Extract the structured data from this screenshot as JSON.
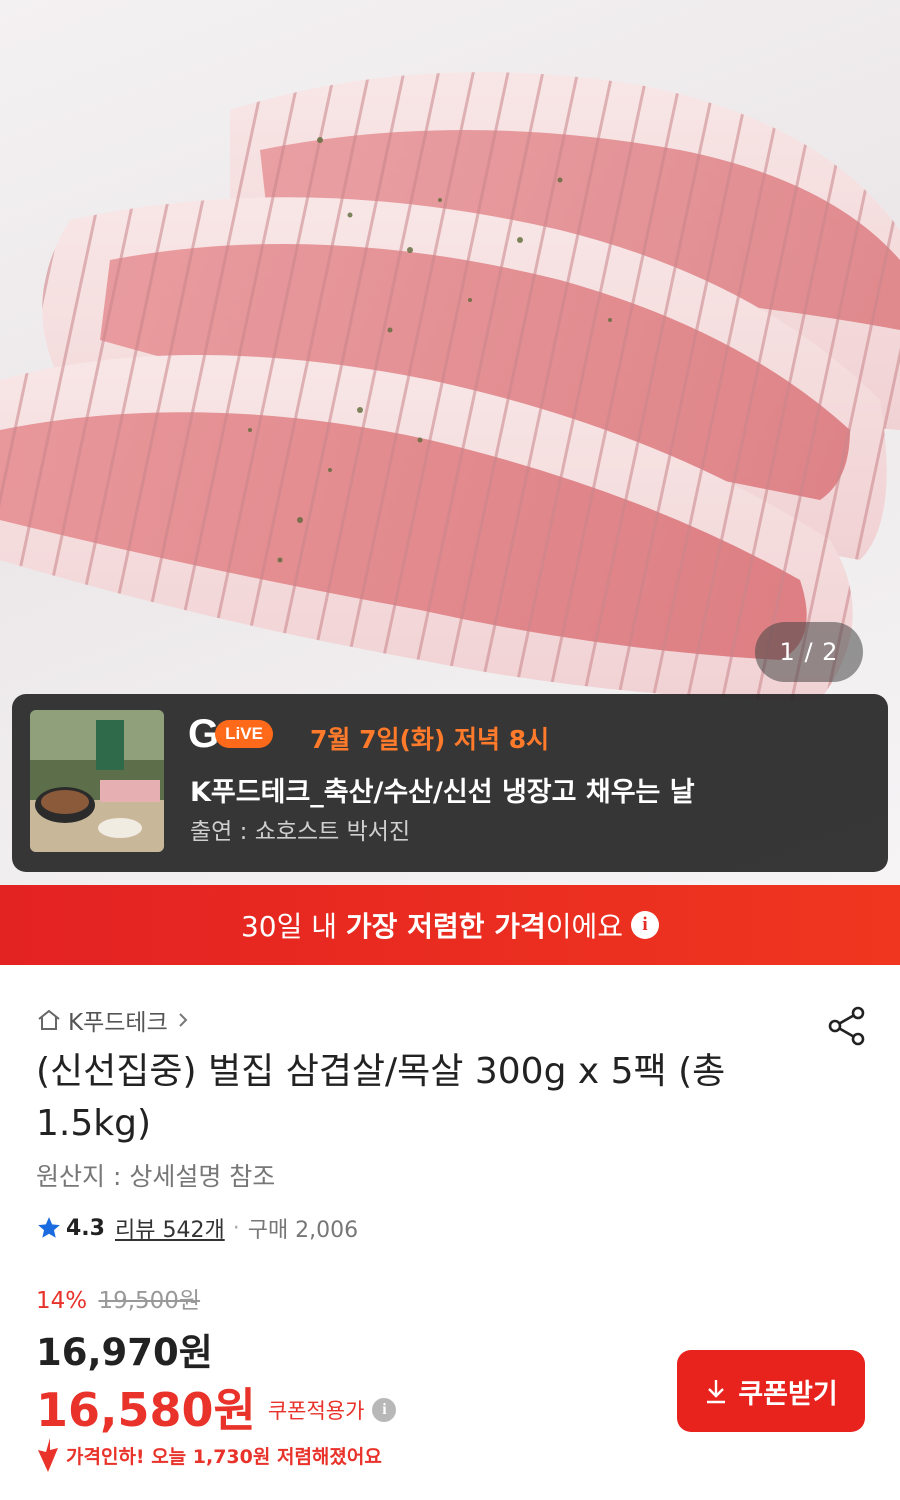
{
  "gallery": {
    "counter": "1 / 2"
  },
  "live": {
    "badge": "LiVE",
    "date": "7월 7일(화) 저녁 8시",
    "title": "K푸드테크_축산/수산/신선 냉장고 채우는 날",
    "cast": "출연 : 쇼호스트 박서진"
  },
  "lowest_banner": {
    "prefix": "30일 내 ",
    "highlight": "가장 저렴한 가격",
    "suffix": "이에요"
  },
  "product": {
    "store": "K푸드테크",
    "title": "(신선집중) 벌집 삼겹살/목살 300g x 5팩 (총 1.5kg)",
    "origin": "원산지 : 상세설명 참조",
    "rating": "4.3",
    "review": "리뷰 542개",
    "purchases": "구매 2,006"
  },
  "pricing": {
    "discount_pct": "14%",
    "original_price": "19,500원",
    "price": "16,970원",
    "coupon_price": "16,580원",
    "coupon_label": "쿠폰적용가",
    "drop_notice": "가격인하! 오늘 1,730원 저렴해졌어요",
    "coupon_button": "쿠폰받기"
  },
  "colors": {
    "accent_red": "#e8322a",
    "live_orange": "#ff6a1a"
  }
}
